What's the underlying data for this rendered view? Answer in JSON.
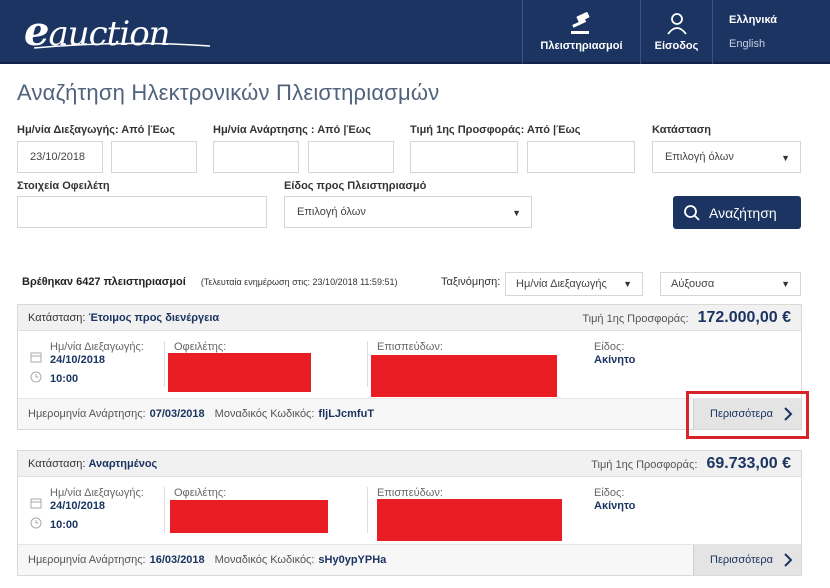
{
  "header": {
    "logo_text": "auction",
    "logo_initial": "e",
    "nav_auctions": "Πλειστηριασμοί",
    "nav_login": "Είσοδος",
    "lang_greek": "Ελληνικά",
    "lang_english": "English"
  },
  "page": {
    "title": "Αναζήτηση Ηλεκτρονικών Πλειστηριασμών"
  },
  "filters": {
    "date_label": "Ημ/νία Διεξαγωγής: Από |Έως",
    "date_from_value": "23/10/2018",
    "date_to_value": "",
    "posting_label": "Ημ/νία Ανάρτησης : Από |Έως",
    "price_label": "Τιμή 1ης Προσφοράς: Από |Έως",
    "status_label": "Κατάσταση",
    "status_value": "Επιλογή όλων",
    "debtor_label": "Στοιχεία Οφειλέτη",
    "kind_label": "Είδος προς Πλειστηριασμό",
    "kind_value": "Επιλογή όλων",
    "search_button": "Αναζήτηση"
  },
  "results": {
    "found_text": "Βρέθηκαν 6427 πλειστηριασμοί",
    "update_note": "(Τελευταία ενημέρωση στις: 23/10/2018 11:59:51)",
    "sort_label": "Ταξινόμηση:",
    "sort_value": "Ημ/νία Διεξαγωγής",
    "order_value": "Αύξουσα"
  },
  "cards": [
    {
      "status_label": "Κατάσταση:",
      "status_value": "Έτοιμος προς διενέργεια",
      "price_label": "Τιμή 1ης Προσφοράς:",
      "price": "172.000,00 €",
      "date_label": "Ημ/νία Διεξαγωγής:",
      "date": "24/10/2018",
      "time": "10:00",
      "debtor_label": "Οφειλέτης:",
      "creditor_label": "Επισπεύδων:",
      "kind_label": "Είδος:",
      "kind_value": "Ακίνητο",
      "posted_label": "Ημερομηνία Ανάρτησης:",
      "posted_value": "07/03/2018",
      "code_label": "Μοναδικός Κωδικός:",
      "code_value": "fljLJcmfuT",
      "more_label": "Περισσότερα"
    },
    {
      "status_label": "Κατάσταση:",
      "status_value": "Αναρτημένος",
      "price_label": "Τιμή 1ης Προσφοράς:",
      "price": "69.733,00 €",
      "date_label": "Ημ/νία Διεξαγωγής:",
      "date": "24/10/2018",
      "time": "10:00",
      "debtor_label": "Οφειλέτης:",
      "creditor_label": "Επισπεύδων:",
      "kind_label": "Είδος:",
      "kind_value": "Ακίνητο",
      "posted_label": "Ημερομηνία Ανάρτησης:",
      "posted_value": "16/03/2018",
      "code_label": "Μοναδικός Κωδικός:",
      "code_value": "sHy0ypYPHa",
      "more_label": "Περισσότερα"
    }
  ],
  "colors": {
    "brand_navy": "#1b3461",
    "redaction": "#ea1c24",
    "highlight_border": "#d8232a"
  }
}
